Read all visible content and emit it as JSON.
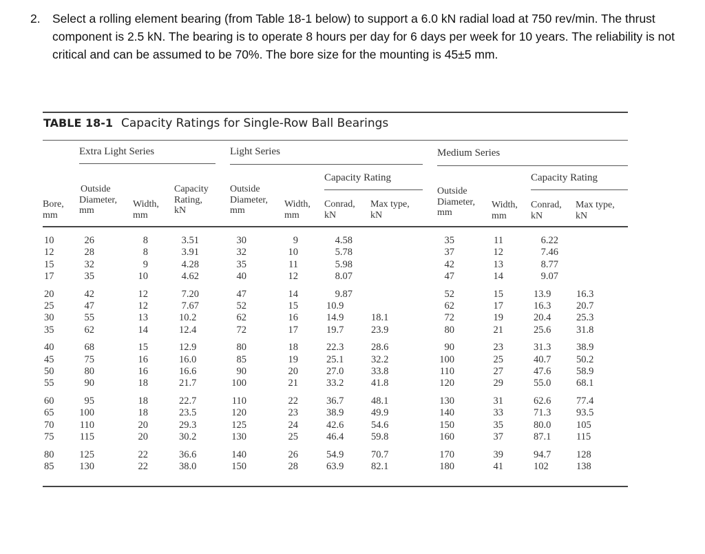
{
  "question": {
    "number": "2.",
    "text": "Select a rolling element bearing (from Table 18-1 below) to support a 6.0 kN radial load at 750 rev/min. The thrust component is 2.5 kN. The bearing is to operate 8 hours per day for 6 days per week for 10 years. The reliability is not critical and can be assumed to be 70%. The bore size for the mounting is 45±5 mm."
  },
  "table": {
    "label": "TABLE 18-1",
    "title": "Capacity Ratings for Single-Row Ball Bearings",
    "series": {
      "extra_light": "Extra Light Series",
      "light": "Light Series",
      "medium": "Medium Series"
    },
    "headers": {
      "capacity_rating_group": "Capacity Rating",
      "bore": [
        "Bore,",
        "mm"
      ],
      "el_od": [
        "Outside",
        "Diameter,",
        "mm"
      ],
      "el_width": [
        "Width,",
        "mm"
      ],
      "el_cap": [
        "Capacity",
        "Rating,",
        "kN"
      ],
      "l_od": [
        "Outside",
        "Diameter,",
        "mm"
      ],
      "l_width": [
        "Width,",
        "mm"
      ],
      "l_conrad": [
        "Conrad,",
        "kN"
      ],
      "l_max": [
        "Max type,",
        "kN"
      ],
      "m_od": [
        "Outside",
        "Diameter,",
        "mm"
      ],
      "m_width": [
        "Width,",
        "mm"
      ],
      "m_conrad": [
        "Conrad,",
        "kN"
      ],
      "m_max": [
        "Max type,",
        "kN"
      ]
    },
    "columns": [
      "bore",
      "el_od",
      "el_width",
      "el_cap",
      "l_od",
      "l_width",
      "l_conrad",
      "l_max",
      "m_od",
      "m_width",
      "m_conrad",
      "m_max"
    ],
    "rows": [
      [
        "10",
        "26",
        "8",
        "3.51",
        "30",
        "9",
        "4.58",
        "",
        "35",
        "11",
        "6.22",
        ""
      ],
      [
        "12",
        "28",
        "8",
        "3.91",
        "32",
        "10",
        "5.78",
        "",
        "37",
        "12",
        "7.46",
        ""
      ],
      [
        "15",
        "32",
        "9",
        "4.28",
        "35",
        "11",
        "5.98",
        "",
        "42",
        "13",
        "8.77",
        ""
      ],
      [
        "17",
        "35",
        "10",
        "4.62",
        "40",
        "12",
        "8.07",
        "",
        "47",
        "14",
        "9.07",
        ""
      ],
      [
        "20",
        "42",
        "12",
        "7.20",
        "47",
        "14",
        "9.87",
        "",
        "52",
        "15",
        "13.9",
        "16.3"
      ],
      [
        "25",
        "47",
        "12",
        "7.67",
        "52",
        "15",
        "10.9",
        "",
        "62",
        "17",
        "16.3",
        "20.7"
      ],
      [
        "30",
        "55",
        "13",
        "10.2",
        "62",
        "16",
        "14.9",
        "18.1",
        "72",
        "19",
        "20.4",
        "25.3"
      ],
      [
        "35",
        "62",
        "14",
        "12.4",
        "72",
        "17",
        "19.7",
        "23.9",
        "80",
        "21",
        "25.6",
        "31.8"
      ],
      [
        "40",
        "68",
        "15",
        "12.9",
        "80",
        "18",
        "22.3",
        "28.6",
        "90",
        "23",
        "31.3",
        "38.9"
      ],
      [
        "45",
        "75",
        "16",
        "16.0",
        "85",
        "19",
        "25.1",
        "32.2",
        "100",
        "25",
        "40.7",
        "50.2"
      ],
      [
        "50",
        "80",
        "16",
        "16.6",
        "90",
        "20",
        "27.0",
        "33.8",
        "110",
        "27",
        "47.6",
        "58.9"
      ],
      [
        "55",
        "90",
        "18",
        "21.7",
        "100",
        "21",
        "33.2",
        "41.8",
        "120",
        "29",
        "55.0",
        "68.1"
      ],
      [
        "60",
        "95",
        "18",
        "22.7",
        "110",
        "22",
        "36.7",
        "48.1",
        "130",
        "31",
        "62.6",
        "77.4"
      ],
      [
        "65",
        "100",
        "18",
        "23.5",
        "120",
        "23",
        "38.9",
        "49.9",
        "140",
        "33",
        "71.3",
        "93.5"
      ],
      [
        "70",
        "110",
        "20",
        "29.3",
        "125",
        "24",
        "42.6",
        "54.6",
        "150",
        "35",
        "80.0",
        "105"
      ],
      [
        "75",
        "115",
        "20",
        "30.2",
        "130",
        "25",
        "46.4",
        "59.8",
        "160",
        "37",
        "87.1",
        "115"
      ],
      [
        "80",
        "125",
        "22",
        "36.6",
        "140",
        "26",
        "54.9",
        "70.7",
        "170",
        "39",
        "94.7",
        "128"
      ],
      [
        "85",
        "130",
        "22",
        "38.0",
        "150",
        "28",
        "63.9",
        "82.1",
        "180",
        "41",
        "102",
        "138"
      ]
    ]
  }
}
